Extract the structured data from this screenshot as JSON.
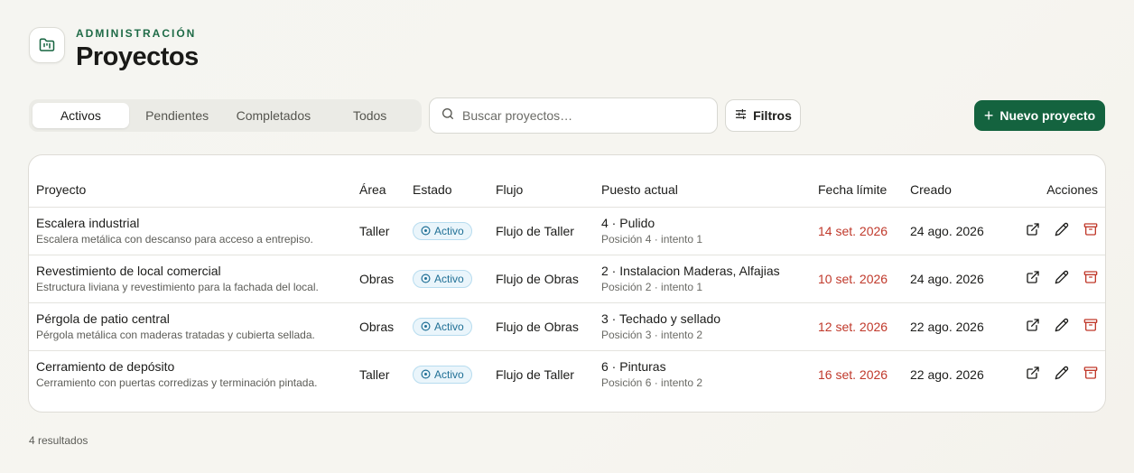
{
  "header": {
    "eyebrow": "ADMINISTRACIÓN",
    "title": "Proyectos",
    "icon": "folder-kanban-icon"
  },
  "tabs": [
    {
      "label": "Activos",
      "active": true
    },
    {
      "label": "Pendientes",
      "active": false
    },
    {
      "label": "Completados",
      "active": false
    },
    {
      "label": "Todos",
      "active": false
    }
  ],
  "search": {
    "placeholder": "Buscar proyectos…",
    "value": "",
    "icon": "search-icon"
  },
  "filters": {
    "label": "Filtros",
    "icon": "sliders-icon"
  },
  "new_button": {
    "label": "Nuevo proyecto",
    "icon": "plus-icon"
  },
  "table": {
    "columns": [
      "Proyecto",
      "Área",
      "Estado",
      "Flujo",
      "Puesto actual",
      "Fecha límite",
      "Creado",
      "Acciones"
    ],
    "rows": [
      {
        "name": "Escalera industrial",
        "description": "Escalera metálica con descanso para acceso a entrepiso.",
        "area": "Taller",
        "status": "Activo",
        "flow": "Flujo de Taller",
        "step": "4 · Pulido",
        "step_detail": "Posición 4 · intento 1",
        "due": "14 set. 2026",
        "created": "24 ago. 2026"
      },
      {
        "name": "Revestimiento de local comercial",
        "description": "Estructura liviana y revestimiento para la fachada del local.",
        "area": "Obras",
        "status": "Activo",
        "flow": "Flujo de Obras",
        "step": "2 · Instalacion Maderas, Alfajias",
        "step_detail": "Posición 2 · intento 1",
        "due": "10 set. 2026",
        "created": "24 ago. 2026"
      },
      {
        "name": "Pérgola de patio central",
        "description": "Pérgola metálica con maderas tratadas y cubierta sellada.",
        "area": "Obras",
        "status": "Activo",
        "flow": "Flujo de Obras",
        "step": "3 · Techado y sellado",
        "step_detail": "Posición 3 · intento 2",
        "due": "12 set. 2026",
        "created": "22 ago. 2026"
      },
      {
        "name": "Cerramiento de depósito",
        "description": "Cerramiento con puertas corredizas y terminación pintada.",
        "area": "Taller",
        "status": "Activo",
        "flow": "Flujo de Taller",
        "step": "6 · Pinturas",
        "step_detail": "Posición 6 · intento 2",
        "due": "16 set. 2026",
        "created": "22 ago. 2026"
      }
    ]
  },
  "footer": {
    "results": "4 resultados"
  },
  "colors": {
    "brand": "#14633f",
    "due_date": "#c0392b",
    "badge": "#1f6f95",
    "archive": "#c0392b"
  }
}
